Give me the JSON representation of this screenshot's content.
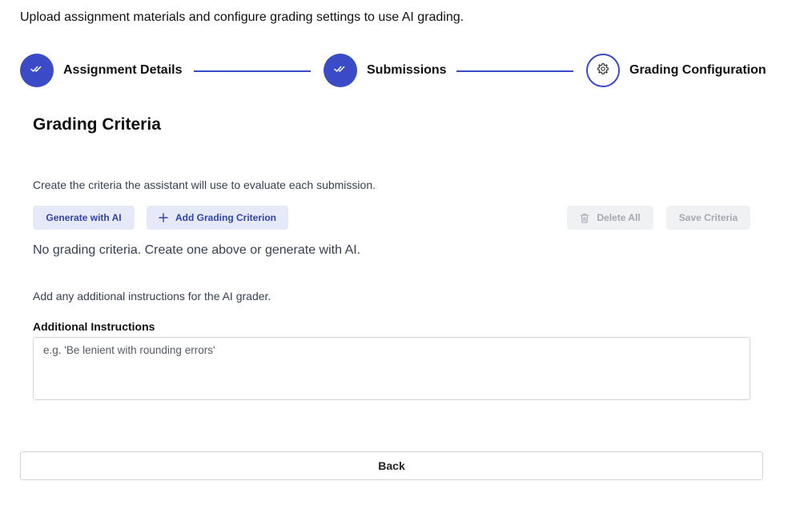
{
  "intro_text": "Upload assignment materials and configure grading settings to use AI grading.",
  "stepper": {
    "steps": [
      {
        "label": "Assignment Details",
        "state": "done",
        "icon": "double-check-icon"
      },
      {
        "label": "Submissions",
        "state": "done",
        "icon": "double-check-icon"
      },
      {
        "label": "Grading Configuration",
        "state": "current",
        "icon": "gear-icon"
      }
    ],
    "accent_color": "#3b4bc8"
  },
  "criteria": {
    "title": "Grading Criteria",
    "description": "Create the criteria the assistant will use to evaluate each submission.",
    "generate_label": "Generate with AI",
    "add_label": "Add Grading Criterion",
    "delete_all_label": "Delete All",
    "save_label": "Save Criteria",
    "empty_text": "No grading criteria. Create one above or generate with AI."
  },
  "instructions": {
    "description": "Add any additional instructions for the AI grader.",
    "label": "Additional Instructions",
    "placeholder": "e.g. 'Be lenient with rounding errors'",
    "value": ""
  },
  "footer": {
    "back_label": "Back"
  }
}
